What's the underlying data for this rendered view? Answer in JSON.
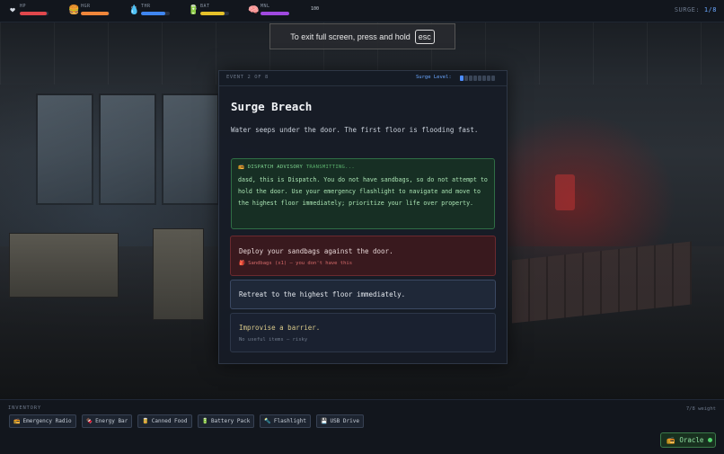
{
  "stats": [
    {
      "icon": "heart-icon",
      "glyph": "❤",
      "label": "HP",
      "value": "95",
      "level": 0.95,
      "color": "#e0474c"
    },
    {
      "icon": "burger-icon",
      "glyph": "🍔",
      "label": "HGR",
      "value": "98",
      "level": 0.98,
      "color": "#f0863a"
    },
    {
      "icon": "water-drop-icon",
      "glyph": "💧",
      "label": "THR",
      "value": "84",
      "level": 0.84,
      "color": "#3f86f0"
    },
    {
      "icon": "battery-icon",
      "glyph": "🔋",
      "label": "BAT",
      "value": "85",
      "level": 0.85,
      "color": "#e6c12a"
    },
    {
      "icon": "brain-icon",
      "glyph": "🧠",
      "label": "MNL",
      "value": "100",
      "level": 1.0,
      "color": "#a049e0"
    }
  ],
  "surge": {
    "label": "SURGE:",
    "value": "1/8"
  },
  "toast": {
    "text": "To exit full screen, press and hold",
    "key": "esc"
  },
  "event": {
    "counter": "EVENT 2 OF 8",
    "surge_label": "Surge Level:",
    "surge_dots_total": 8,
    "surge_dots_on": 1,
    "title": "Surge Breach",
    "description": "Water seeps under the door. The first floor is flooding fast."
  },
  "advisory": {
    "icon": "radio-icon",
    "header_title": "DISPATCH ADVISORY",
    "header_status": "TRANSMITTING...",
    "text": "dasd, this is Dispatch. You do not have sandbags, so do not attempt to hold the door. Use your emergency flashlight to navigate and move to the highest floor immediately; prioritize your life over property."
  },
  "choices": [
    {
      "text": "Deploy your sandbags against the door.",
      "subtext": "🎒 Sandbags (x1) — you don't have this"
    },
    {
      "text": "Retreat to the highest floor immediately.",
      "subtext": ""
    },
    {
      "text": "Improvise a barrier.",
      "subtext": "No useful items — risky"
    }
  ],
  "inventory": {
    "label": "INVENTORY",
    "weight": "7/8 weight",
    "items": [
      {
        "icon": "radio-icon",
        "glyph": "📻",
        "label": "Emergency Radio"
      },
      {
        "icon": "energy-bar-icon",
        "glyph": "🍫",
        "label": "Energy Bar"
      },
      {
        "icon": "canned-food-icon",
        "glyph": "🥫",
        "label": "Canned Food"
      },
      {
        "icon": "battery-icon",
        "glyph": "🔋",
        "label": "Battery Pack"
      },
      {
        "icon": "flashlight-icon",
        "glyph": "🔦",
        "label": "Flashlight"
      },
      {
        "icon": "usb-drive-icon",
        "glyph": "💾",
        "label": "USB Drive"
      }
    ]
  },
  "oracle": {
    "icon": "radio-icon",
    "glyph": "📻",
    "label": "Oracle",
    "status_color": "#4fd36b"
  }
}
